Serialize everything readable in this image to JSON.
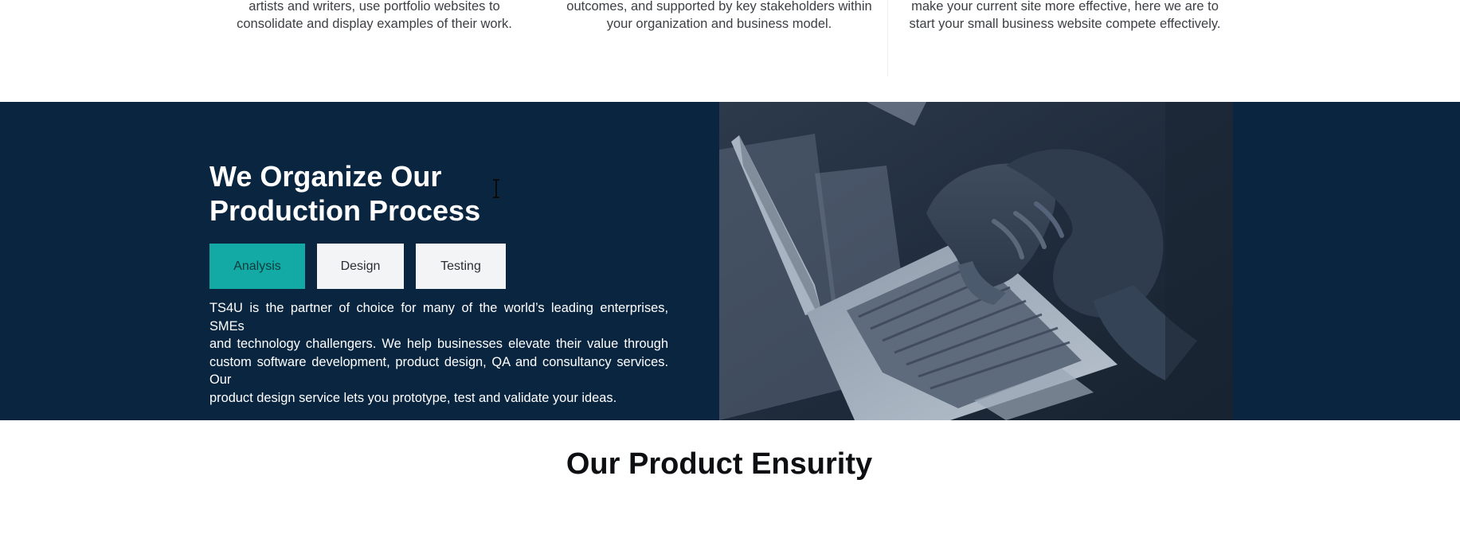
{
  "top_cards": [
    {
      "lines": [
        "artists and writers, use portfolio websites to",
        "consolidate and display examples of their work."
      ]
    },
    {
      "lines": [
        "outcomes, and supported by key stakeholders within",
        "your organization and business model."
      ]
    },
    {
      "lines": [
        "make your current site more effective, here we are to",
        "start your small business website compete effectively."
      ]
    }
  ],
  "process": {
    "title_lines": [
      "We Organize Our",
      "Production Process"
    ],
    "tabs": [
      {
        "label": "Analysis",
        "active": true
      },
      {
        "label": "Design",
        "active": false
      },
      {
        "label": "Testing",
        "active": false
      }
    ],
    "description_lines": [
      "TS4U is the partner of choice for many of the world’s leading enterprises, SMEs",
      "and technology challengers. We help businesses elevate their value through",
      "custom software development, product design, QA and consultancy services. Our",
      "product design service lets you prototype, test and validate your ideas."
    ],
    "image_subject": "hands-typing-on-laptop",
    "colors": {
      "background": "#0a2540",
      "accent": "#13aaa6"
    }
  },
  "ensurity": {
    "title": "Our Product Ensurity"
  }
}
